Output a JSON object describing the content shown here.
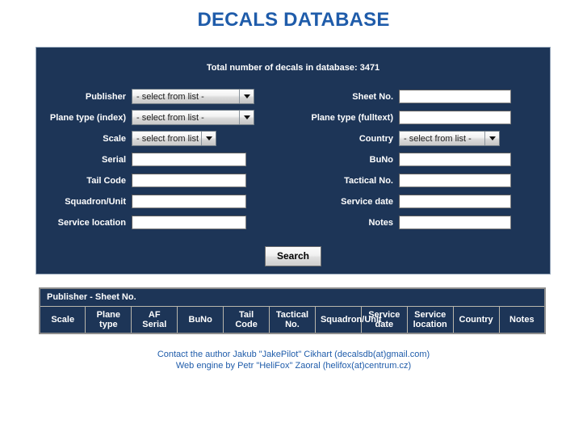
{
  "page": {
    "title": "DECALS DATABASE",
    "total_text": "Total number of decals in database: 3471",
    "title_color": "#1f5caa",
    "panel_color": "#1d3557"
  },
  "search_form": {
    "select_placeholder": "- select from list -",
    "left_fields": [
      {
        "label": "Publisher",
        "type": "select",
        "value": "- select from list -"
      },
      {
        "label": "Plane type (index)",
        "type": "select",
        "value": "- select from list -"
      },
      {
        "label": "Scale",
        "type": "select",
        "value": "- select from list -"
      },
      {
        "label": "Serial",
        "type": "text",
        "value": ""
      },
      {
        "label": "Tail Code",
        "type": "text",
        "value": ""
      },
      {
        "label": "Squadron/Unit",
        "type": "text",
        "value": ""
      },
      {
        "label": "Service location",
        "type": "text",
        "value": ""
      }
    ],
    "right_fields": [
      {
        "label": "Sheet No.",
        "type": "text",
        "value": ""
      },
      {
        "label": "Plane type (fulltext)",
        "type": "text",
        "value": ""
      },
      {
        "label": "Country",
        "type": "select",
        "value": "- select from list -"
      },
      {
        "label": "BuNo",
        "type": "text",
        "value": ""
      },
      {
        "label": "Tactical No.",
        "type": "text",
        "value": ""
      },
      {
        "label": "Service date",
        "type": "text",
        "value": ""
      },
      {
        "label": "Notes",
        "type": "text",
        "value": ""
      }
    ],
    "search_button": "Search"
  },
  "results_table": {
    "group_header": "Publisher - Sheet No.",
    "columns": [
      "Scale",
      "Plane type",
      "AF Serial",
      "BuNo",
      "Tail Code",
      "Tactical No.",
      "Squadron/Unit",
      "Service date",
      "Service location",
      "Country",
      "Notes"
    ],
    "rows": []
  },
  "footer": {
    "line1": "Contact the author Jakub \"JakePilot\" Cikhart (decalsdb(at)gmail.com)",
    "line2": "Web engine by Petr \"HeliFox\" Zaoral (helifox(at)centrum.cz)"
  }
}
